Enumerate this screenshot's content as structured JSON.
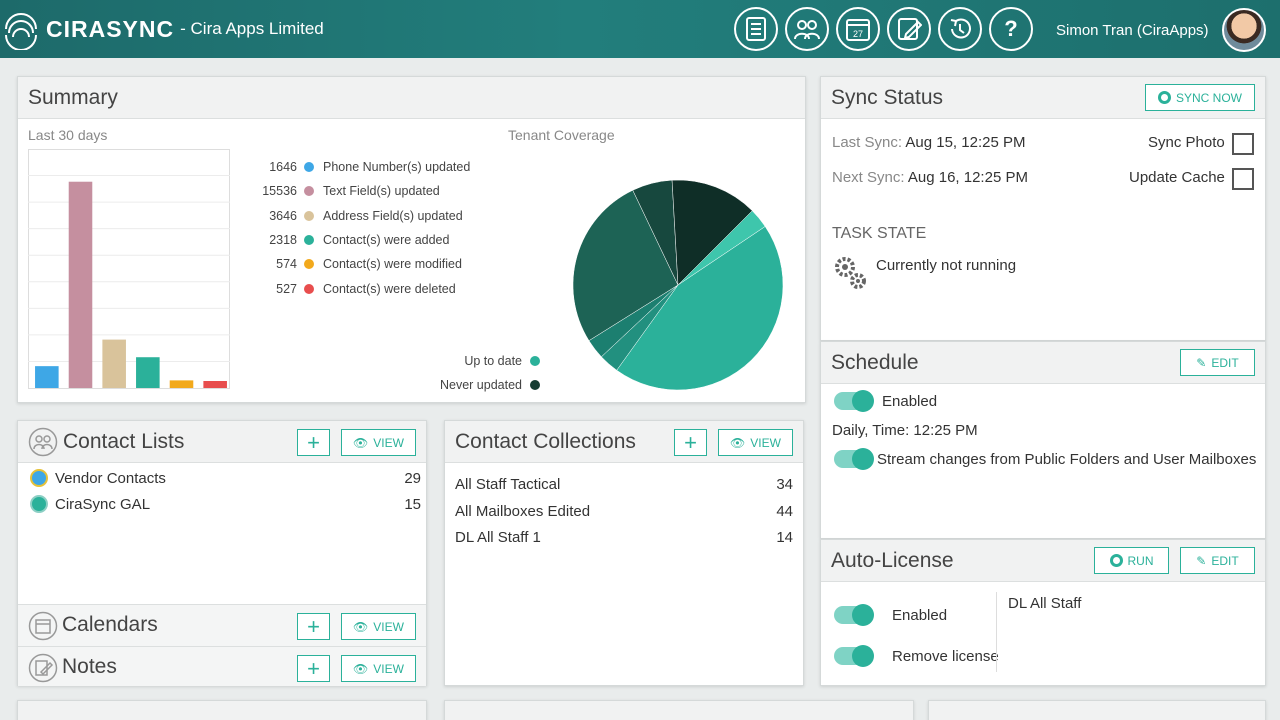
{
  "header": {
    "brand_name": "CIRASYNC",
    "company": "- Cira Apps Limited",
    "icons": [
      "contacts-icon",
      "groups-icon",
      "calendar-icon",
      "notes-icon",
      "history-icon",
      "help-icon"
    ],
    "calendar_day": "27",
    "help_glyph": "?",
    "user_name": "Simon Tran (CiraApps)"
  },
  "summary": {
    "title": "Summary",
    "period": "Last 30 days",
    "coverage_title": "Tenant Coverage",
    "legend": [
      {
        "count": "1646",
        "label": "Phone Number(s) updated",
        "color": "#3ea7e6"
      },
      {
        "count": "15536",
        "label": "Text Field(s) updated",
        "color": "#c58f9f"
      },
      {
        "count": "3646",
        "label": "Address Field(s) updated",
        "color": "#d9c39b"
      },
      {
        "count": "2318",
        "label": "Contact(s) were added",
        "color": "#2bb19a"
      },
      {
        "count": "574",
        "label": "Contact(s) were modified",
        "color": "#f2a91c"
      },
      {
        "count": "527",
        "label": "Contact(s) were deleted",
        "color": "#e84e4e"
      }
    ],
    "coverage_legend": [
      {
        "label": "Up to date",
        "color": "#2bb19a"
      },
      {
        "label": "Never updated",
        "color": "#163d33"
      }
    ]
  },
  "chart_data": [
    {
      "type": "bar",
      "categories": [
        "Phone Number(s) updated",
        "Text Field(s) updated",
        "Address Field(s) updated",
        "Contact(s) were added",
        "Contact(s) were modified",
        "Contact(s) were deleted"
      ],
      "values": [
        1646,
        15536,
        3646,
        2318,
        574,
        527
      ],
      "colors": [
        "#3ea7e6",
        "#c58f9f",
        "#d9c39b",
        "#2bb19a",
        "#f2a91c",
        "#e84e4e"
      ],
      "title": "Last 30 days",
      "ylim": [
        0,
        18000
      ],
      "grid": true
    },
    {
      "type": "pie",
      "title": "Tenant Coverage",
      "categories": [
        "Up to date",
        "Never updated"
      ],
      "slices": [
        {
          "value": 3,
          "color": "#3ec6ac"
        },
        {
          "value": 43,
          "color": "#2bb19a"
        },
        {
          "value": 3,
          "color": "#22907f"
        },
        {
          "value": 3,
          "color": "#1c7f70"
        },
        {
          "value": 26,
          "color": "#1d6355"
        },
        {
          "value": 6,
          "color": "#17483e"
        },
        {
          "value": 13,
          "color": "#0f2e27"
        }
      ]
    }
  ],
  "sync_status": {
    "title": "Sync Status",
    "sync_now": "SYNC NOW",
    "last_sync_label": "Last Sync:",
    "last_sync_value": "Aug 15, 12:25 PM",
    "next_sync_label": "Next Sync:",
    "next_sync_value": "Aug 16, 12:25 PM",
    "sync_photo": "Sync Photo",
    "update_cache": "Update Cache",
    "task_state_label": "TASK STATE",
    "task_state_value": "Currently not running"
  },
  "schedule": {
    "title": "Schedule",
    "edit": "EDIT",
    "enabled": "Enabled",
    "time": "Daily, Time: 12:25 PM",
    "stream": "Stream changes from Public Folders and User Mailboxes"
  },
  "auto_license": {
    "title": "Auto-License",
    "run": "RUN",
    "edit": "EDIT",
    "enabled": "Enabled",
    "remove_license": "Remove license",
    "group": "DL All Staff"
  },
  "contact_lists": {
    "title": "Contact Lists",
    "view": "VIEW",
    "items": [
      {
        "label": "Vendor Contacts",
        "count": "29"
      },
      {
        "label": "CiraSync GAL",
        "count": "15"
      }
    ]
  },
  "calendars": {
    "title": "Calendars",
    "view": "VIEW"
  },
  "notes": {
    "title": "Notes",
    "view": "VIEW"
  },
  "contact_collections": {
    "title": "Contact Collections",
    "view": "VIEW",
    "items": [
      {
        "label": "All Staff Tactical",
        "count": "34"
      },
      {
        "label": "All Mailboxes Edited",
        "count": "44"
      },
      {
        "label": "DL All Staff 1",
        "count": "14"
      }
    ]
  },
  "plus": "+"
}
